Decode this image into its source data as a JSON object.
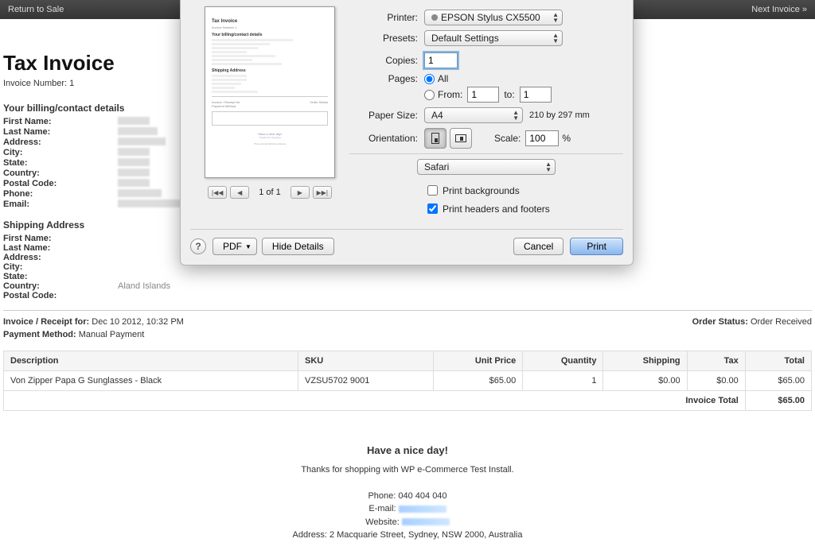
{
  "topbar": {
    "return": "Return to Sale",
    "next": "Next Invoice »"
  },
  "invoice": {
    "title": "Tax Invoice",
    "number_label": "Invoice Number: 1",
    "billing_heading": "Your billing/contact details",
    "labels": {
      "first_name": "First Name:",
      "last_name": "Last Name:",
      "address": "Address:",
      "city": "City:",
      "state": "State:",
      "country": "Country:",
      "postal_code": "Postal Code:",
      "phone": "Phone:",
      "email": "Email:"
    },
    "shipping_heading": "Shipping Address",
    "shipping_country": "Aland Islands",
    "meta": {
      "receipt_label": "Invoice / Receipt for:",
      "receipt_value": "Dec 10 2012, 10:32 PM",
      "order_status_label": "Order Status:",
      "order_status_value": "Order Received",
      "payment_method_label": "Payment Method:",
      "payment_method_value": "Manual Payment"
    },
    "table": {
      "headers": {
        "description": "Description",
        "sku": "SKU",
        "unit_price": "Unit Price",
        "quantity": "Quantity",
        "shipping": "Shipping",
        "tax": "Tax",
        "total": "Total"
      },
      "row": {
        "description": "Von Zipper Papa G Sunglasses - Black",
        "sku": "VZSU5702 9001",
        "unit_price": "$65.00",
        "quantity": "1",
        "shipping": "$0.00",
        "tax": "$0.00",
        "total": "$65.00"
      },
      "invoice_total_label": "Invoice Total",
      "invoice_total_value": "$65.00"
    },
    "footer": {
      "nice_day": "Have a nice day!",
      "thanks": "Thanks for shopping with WP e-Commerce Test Install.",
      "phone": "Phone: 040 404 040",
      "email_label": "E-mail: ",
      "website_label": "Website: ",
      "address": "Address: 2 Macquarie Street, Sydney, NSW 2000, Australia"
    }
  },
  "dialog": {
    "printer_label": "Printer:",
    "printer_value": "EPSON Stylus CX5500",
    "presets_label": "Presets:",
    "presets_value": "Default Settings",
    "copies_label": "Copies:",
    "copies_value": "1",
    "pages_label": "Pages:",
    "pages_all": "All",
    "pages_from": "From:",
    "pages_from_value": "1",
    "pages_to": "to:",
    "pages_to_value": "1",
    "paper_size_label": "Paper Size:",
    "paper_size_value": "A4",
    "paper_dims": "210 by 297 mm",
    "orientation_label": "Orientation:",
    "scale_label": "Scale:",
    "scale_value": "100",
    "scale_pct": "%",
    "app_value": "Safari",
    "print_backgrounds": "Print backgrounds",
    "print_headers": "Print headers and footers",
    "page_of": "1 of 1",
    "help": "?",
    "pdf": "PDF",
    "hide_details": "Hide Details",
    "cancel": "Cancel",
    "print": "Print",
    "preview_title": "Tax Invoice"
  }
}
